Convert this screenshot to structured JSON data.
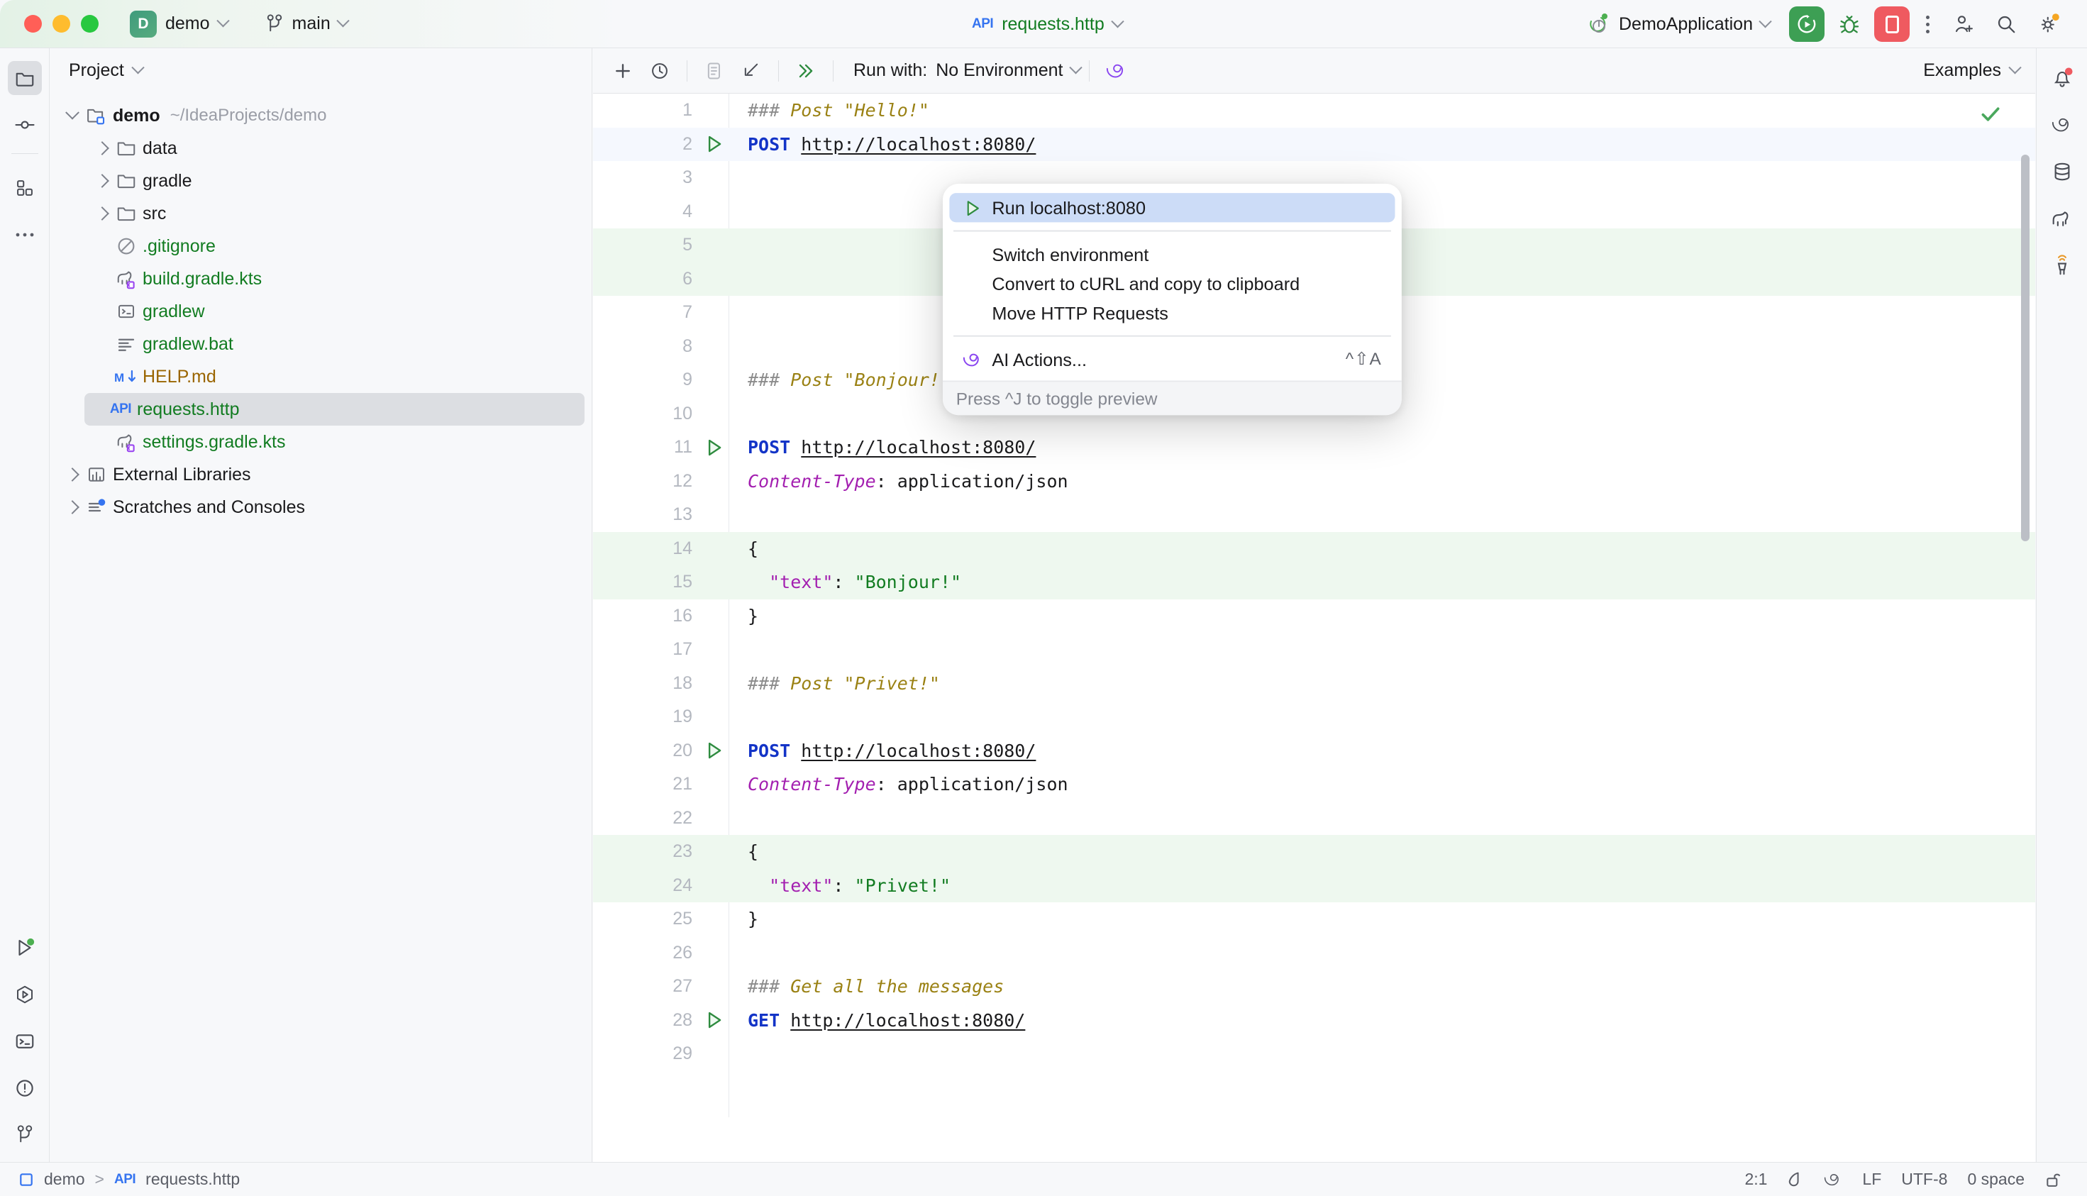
{
  "titlebar": {
    "project_badge": "D",
    "project_name": "demo",
    "branch_icon": "branch-icon",
    "branch_name": "main",
    "file_api_glyph": "API",
    "file_name": "requests.http",
    "run_config_icon": "spring-boot-icon",
    "run_config_name": "DemoApplication",
    "run_button_icon": "run-with-coverage-icon",
    "debug_button_icon": "debug-bug-icon",
    "stop_button_icon": "stop-icon",
    "more_button_icon": "more-vertical-icon",
    "share_icon": "add-user-icon",
    "search_icon": "search-icon",
    "settings_icon": "gear-icon"
  },
  "left_stripe": {
    "items": [
      {
        "name": "project-tool-window",
        "icon": "folder-icon",
        "active": true
      },
      {
        "name": "commit-tool-window",
        "icon": "commit-node-icon",
        "active": false
      },
      {
        "name": "structure-tool-window",
        "icon": "structure-squares-icon",
        "active": false
      },
      {
        "name": "more-tool-windows",
        "icon": "more-horizontal-icon",
        "active": false
      }
    ],
    "bottom_items": [
      {
        "name": "run-tool-window",
        "icon": "run-dot-icon"
      },
      {
        "name": "services-tool-window",
        "icon": "services-hexagon-icon"
      },
      {
        "name": "terminal-tool-window",
        "icon": "terminal-icon"
      },
      {
        "name": "problems-tool-window",
        "icon": "problems-warning-icon"
      },
      {
        "name": "version-control-tool-window",
        "icon": "branch-icon"
      }
    ]
  },
  "right_stripe": {
    "items": [
      {
        "name": "notifications",
        "icon": "bell-icon",
        "badge": true
      },
      {
        "name": "ai-assistant",
        "icon": "ai-spiral-icon"
      },
      {
        "name": "database",
        "icon": "database-icon"
      },
      {
        "name": "gradle",
        "icon": "gradle-elephant-icon"
      },
      {
        "name": "endpoints",
        "icon": "endpoints-icon"
      }
    ]
  },
  "project_panel": {
    "header": "Project",
    "tree": [
      {
        "depth": 0,
        "arrow": "down",
        "icon": "module-folder-icon",
        "name": "demo",
        "path": "~/IdeaProjects/demo",
        "color": "blk",
        "bold": true
      },
      {
        "depth": 1,
        "arrow": "right",
        "icon": "folder-icon",
        "name": "data",
        "color": "blk"
      },
      {
        "depth": 1,
        "arrow": "right",
        "icon": "folder-icon",
        "name": "gradle",
        "color": "blk"
      },
      {
        "depth": 1,
        "arrow": "right",
        "icon": "folder-icon",
        "name": "src",
        "color": "blk"
      },
      {
        "depth": 1,
        "arrow": "none",
        "icon": "gitignore-icon",
        "name": ".gitignore",
        "color": "grn"
      },
      {
        "depth": 1,
        "arrow": "none",
        "icon": "gradle-kts-icon",
        "name": "build.gradle.kts",
        "color": "grn"
      },
      {
        "depth": 1,
        "arrow": "none",
        "icon": "shell-script-icon",
        "name": "gradlew",
        "color": "grn"
      },
      {
        "depth": 1,
        "arrow": "none",
        "icon": "text-file-icon",
        "name": "gradlew.bat",
        "color": "grn"
      },
      {
        "depth": 1,
        "arrow": "none",
        "icon": "markdown-icon",
        "name": "HELP.md",
        "color": "org"
      },
      {
        "depth": 1,
        "arrow": "none",
        "icon": "http-api-icon",
        "name": "requests.http",
        "color": "grn",
        "selected": true
      },
      {
        "depth": 1,
        "arrow": "none",
        "icon": "gradle-kts-icon",
        "name": "settings.gradle.kts",
        "color": "grn"
      },
      {
        "depth": 0,
        "arrow": "right",
        "icon": "external-libraries-icon",
        "name": "External Libraries",
        "color": "blk"
      },
      {
        "depth": 0,
        "arrow": "right",
        "icon": "scratches-icon",
        "name": "Scratches and Consoles",
        "color": "blk"
      }
    ]
  },
  "editor_toolbar": {
    "add_icon": "plus-icon",
    "history_icon": "clock-history-icon",
    "examples_doc_icon": "document-icon",
    "import_icon": "import-arrow-icon",
    "run_all_icon": "run-all-double-chevron-icon",
    "run_with_label": "Run with:",
    "environment_value": "No Environment",
    "ai_icon": "ai-spiral-icon",
    "examples_label": "Examples"
  },
  "editor": {
    "inspection_status_icon": "checkmark-green-icon",
    "lines": [
      {
        "n": "1",
        "run": false,
        "cur": false,
        "bg": "none",
        "spans": [
          {
            "t": "### ",
            "c": "c-comment"
          },
          {
            "t": "Post \"Hello!\"",
            "c": "c-title"
          }
        ]
      },
      {
        "n": "2",
        "run": true,
        "cur": true,
        "bg": "none",
        "spans": [
          {
            "t": "POST ",
            "c": "c-method"
          },
          {
            "t": "http://localhost:8080/",
            "c": "c-url"
          }
        ]
      },
      {
        "n": "3",
        "run": false,
        "cur": false,
        "bg": "none",
        "spans": []
      },
      {
        "n": "4",
        "run": false,
        "cur": false,
        "bg": "none",
        "spans": []
      },
      {
        "n": "5",
        "run": false,
        "cur": false,
        "bg": "green",
        "spans": []
      },
      {
        "n": "6",
        "run": false,
        "cur": false,
        "bg": "green",
        "spans": []
      },
      {
        "n": "7",
        "run": false,
        "cur": false,
        "bg": "none",
        "spans": []
      },
      {
        "n": "8",
        "run": false,
        "cur": false,
        "bg": "none",
        "spans": []
      },
      {
        "n": "9",
        "run": false,
        "cur": false,
        "bg": "none",
        "spans": [
          {
            "t": "### ",
            "c": "c-comment"
          },
          {
            "t": "Post \"Bonjour!\"",
            "c": "c-title"
          }
        ]
      },
      {
        "n": "10",
        "run": false,
        "cur": false,
        "bg": "none",
        "spans": []
      },
      {
        "n": "11",
        "run": true,
        "cur": false,
        "bg": "none",
        "spans": [
          {
            "t": "POST ",
            "c": "c-method"
          },
          {
            "t": "http://localhost:8080/",
            "c": "c-url"
          }
        ]
      },
      {
        "n": "12",
        "run": false,
        "cur": false,
        "bg": "none",
        "spans": [
          {
            "t": "Content-Type",
            "c": "c-header"
          },
          {
            "t": ": application/json",
            "c": "c-plain"
          }
        ]
      },
      {
        "n": "13",
        "run": false,
        "cur": false,
        "bg": "none",
        "spans": []
      },
      {
        "n": "14",
        "run": false,
        "cur": false,
        "bg": "green",
        "spans": [
          {
            "t": "{",
            "c": "c-plain"
          }
        ]
      },
      {
        "n": "15",
        "run": false,
        "cur": false,
        "bg": "green",
        "spans": [
          {
            "t": "  ",
            "c": "c-plain"
          },
          {
            "t": "\"text\"",
            "c": "c-key"
          },
          {
            "t": ": ",
            "c": "c-plain"
          },
          {
            "t": "\"Bonjour!\"",
            "c": "c-str"
          }
        ]
      },
      {
        "n": "16",
        "run": false,
        "cur": false,
        "bg": "none",
        "spans": [
          {
            "t": "}",
            "c": "c-plain"
          }
        ]
      },
      {
        "n": "17",
        "run": false,
        "cur": false,
        "bg": "none",
        "spans": []
      },
      {
        "n": "18",
        "run": false,
        "cur": false,
        "bg": "none",
        "spans": [
          {
            "t": "### ",
            "c": "c-comment"
          },
          {
            "t": "Post \"Privet!\"",
            "c": "c-title"
          }
        ]
      },
      {
        "n": "19",
        "run": false,
        "cur": false,
        "bg": "none",
        "spans": []
      },
      {
        "n": "20",
        "run": true,
        "cur": false,
        "bg": "none",
        "spans": [
          {
            "t": "POST ",
            "c": "c-method"
          },
          {
            "t": "http://localhost:8080/",
            "c": "c-url"
          }
        ]
      },
      {
        "n": "21",
        "run": false,
        "cur": false,
        "bg": "none",
        "spans": [
          {
            "t": "Content-Type",
            "c": "c-header"
          },
          {
            "t": ": application/json",
            "c": "c-plain"
          }
        ]
      },
      {
        "n": "22",
        "run": false,
        "cur": false,
        "bg": "none",
        "spans": []
      },
      {
        "n": "23",
        "run": false,
        "cur": false,
        "bg": "green",
        "spans": [
          {
            "t": "{",
            "c": "c-plain"
          }
        ]
      },
      {
        "n": "24",
        "run": false,
        "cur": false,
        "bg": "green",
        "spans": [
          {
            "t": "  ",
            "c": "c-plain"
          },
          {
            "t": "\"text\"",
            "c": "c-key"
          },
          {
            "t": ": ",
            "c": "c-plain"
          },
          {
            "t": "\"Privet!\"",
            "c": "c-str"
          }
        ]
      },
      {
        "n": "25",
        "run": false,
        "cur": false,
        "bg": "none",
        "spans": [
          {
            "t": "}",
            "c": "c-plain"
          }
        ]
      },
      {
        "n": "26",
        "run": false,
        "cur": false,
        "bg": "none",
        "spans": []
      },
      {
        "n": "27",
        "run": false,
        "cur": false,
        "bg": "none",
        "spans": [
          {
            "t": "### ",
            "c": "c-comment"
          },
          {
            "t": "Get all the messages",
            "c": "c-title"
          }
        ]
      },
      {
        "n": "28",
        "run": true,
        "cur": false,
        "bg": "none",
        "spans": [
          {
            "t": "GET ",
            "c": "c-method"
          },
          {
            "t": "http://localhost:8080/",
            "c": "c-url"
          }
        ]
      },
      {
        "n": "29",
        "run": false,
        "cur": false,
        "bg": "none",
        "spans": []
      }
    ]
  },
  "popup": {
    "items": [
      {
        "label": "Run localhost:8080",
        "icon": "run-triangle-icon",
        "selected": true,
        "shortcut": ""
      },
      {
        "sep": true
      },
      {
        "label": "Switch environment",
        "icon": "",
        "selected": false,
        "shortcut": ""
      },
      {
        "label": "Convert to cURL and copy to clipboard",
        "icon": "",
        "selected": false,
        "shortcut": ""
      },
      {
        "label": "Move HTTP Requests",
        "icon": "",
        "selected": false,
        "shortcut": ""
      },
      {
        "sep": true
      },
      {
        "label": "AI Actions...",
        "icon": "ai-spiral-icon",
        "selected": false,
        "shortcut": "^⇧A"
      }
    ],
    "footer": "Press ^J to toggle preview"
  },
  "statusbar": {
    "breadcrumb_module_icon": "module-square-icon",
    "breadcrumb_module": "demo",
    "breadcrumb_sep": ">",
    "breadcrumb_file_glyph": "API",
    "breadcrumb_file": "requests.http",
    "caret_position": "2:1",
    "indent_icon": "indent-drop-icon",
    "ai_icon": "ai-spiral-icon",
    "line_separator": "LF",
    "encoding": "UTF-8",
    "indent": "0 space",
    "lock_icon": "lock-open-icon"
  }
}
